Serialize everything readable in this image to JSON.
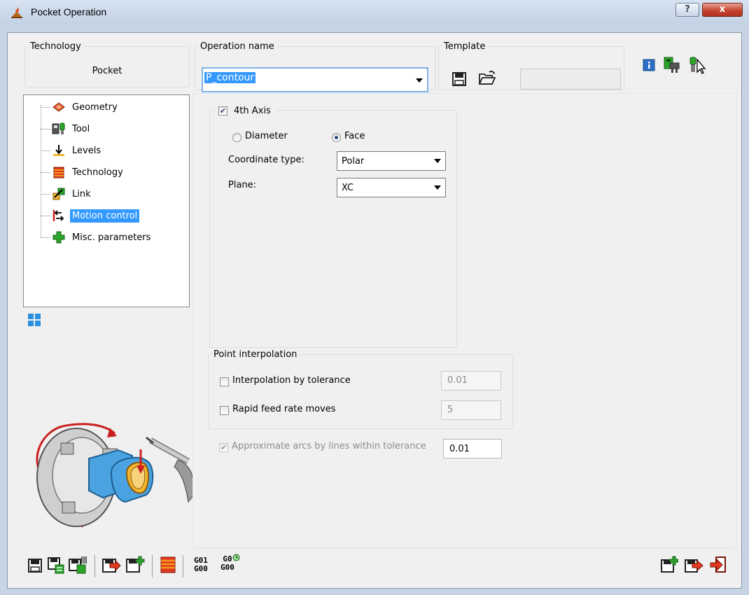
{
  "window": {
    "title": "Pocket Operation",
    "help_label": "?",
    "close_label": "x"
  },
  "technology": {
    "legend": "Technology",
    "value": "Pocket"
  },
  "operation_name": {
    "legend": "Operation name",
    "value": "P_contour"
  },
  "template": {
    "legend": "Template",
    "value": ""
  },
  "tree": {
    "items": [
      {
        "label": "Geometry",
        "icon": "geometry-icon"
      },
      {
        "label": "Tool",
        "icon": "tool-icon"
      },
      {
        "label": "Levels",
        "icon": "levels-icon"
      },
      {
        "label": "Technology",
        "icon": "technology-icon"
      },
      {
        "label": "Link",
        "icon": "link-icon"
      },
      {
        "label": "Motion control",
        "icon": "motion-control-icon",
        "selected": true
      },
      {
        "label": "Misc. parameters",
        "icon": "misc-parameters-icon"
      }
    ]
  },
  "axis4": {
    "legend": "4th Axis",
    "checked": true,
    "diameter_label": "Diameter",
    "face_label": "Face",
    "selected_radio": "Face",
    "coordinate_type_label": "Coordinate type:",
    "coordinate_type_value": "Polar",
    "plane_label": "Plane:",
    "plane_value": "XC"
  },
  "point_interp": {
    "legend": "Point interpolation",
    "interp_tol_label": "Interpolation by tolerance",
    "interp_tol_checked": false,
    "interp_tol_value": "0.01",
    "rapid_label": "Rapid feed rate moves",
    "rapid_checked": false,
    "rapid_value": "5"
  },
  "approx": {
    "label": "Approximate arcs by lines within tolerance",
    "checked": true,
    "value": "0.01"
  },
  "toolbar": {
    "g01": "G01",
    "g00a": "G00",
    "g0": "G0",
    "g00b": "G00"
  },
  "colors": {
    "selection": "#3399ff",
    "accent_red": "#cc2020",
    "accent_green": "#2aa52a",
    "part_blue": "#4aa3e0",
    "part_yellow": "#f2b630"
  }
}
